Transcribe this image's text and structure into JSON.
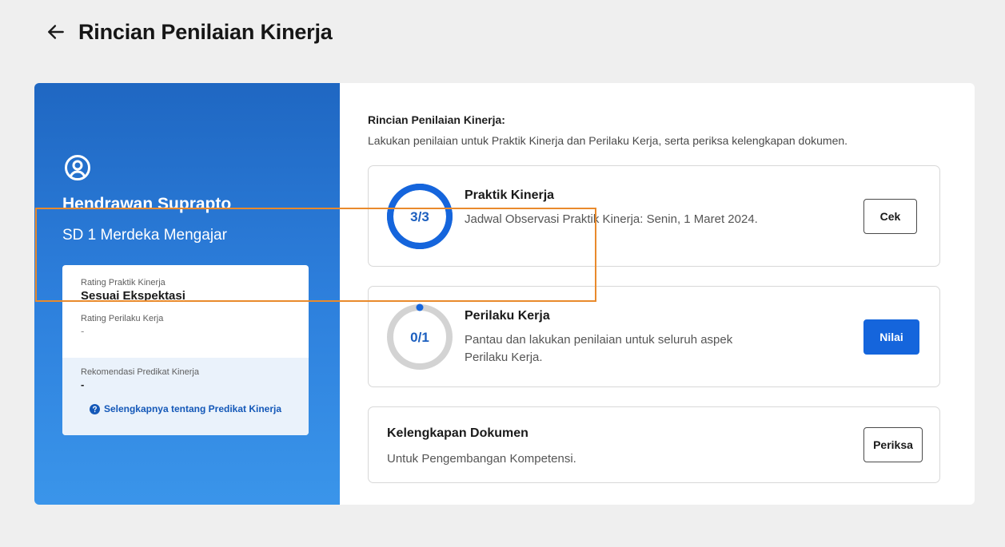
{
  "header": {
    "title": "Rincian Penilaian Kinerja",
    "back_icon": "arrow-left-icon"
  },
  "profile": {
    "icon": "user-circle-icon",
    "name": "Hendrawan Suprapto",
    "school": "SD 1 Merdeka Mengajar"
  },
  "ratings": {
    "praktik_label": "Rating Praktik Kinerja",
    "praktik_value": "Sesuai Ekspektasi",
    "perilaku_label": "Rating Perilaku Kerja",
    "perilaku_value": "-",
    "rekomendasi_label": "Rekomendasi Predikat Kinerja",
    "rekomendasi_value": "-",
    "link_label": "Selengkapnya tentang Predikat Kinerja",
    "link_icon": "question-circle-icon"
  },
  "section": {
    "title": "Rincian Penilaian Kinerja:",
    "subtitle": "Lakukan penilaian untuk Praktik Kinerja dan Perilaku Kerja, serta periksa kelengkapan dokumen."
  },
  "items": [
    {
      "progress_text": "3/3",
      "progress": 1.0,
      "title": "Praktik Kinerja",
      "description": "Jadwal Observasi Praktik Kinerja: Senin, 1 Maret 2024.",
      "button": "Cek"
    },
    {
      "progress_text": "0/1",
      "progress": 0.0,
      "title": "Perilaku Kerja",
      "description": "Pantau dan lakukan penilaian untuk seluruh aspek Perilaku Kerja.",
      "button": "Nilai"
    },
    {
      "title": "Kelengkapan Dokumen",
      "description": "Untuk Pengembangan Kompetensi.",
      "button": "Periksa"
    }
  ],
  "colors": {
    "accent": "#1565dc",
    "ring_track": "#d3d3d3",
    "highlight": "#e98a2c"
  }
}
